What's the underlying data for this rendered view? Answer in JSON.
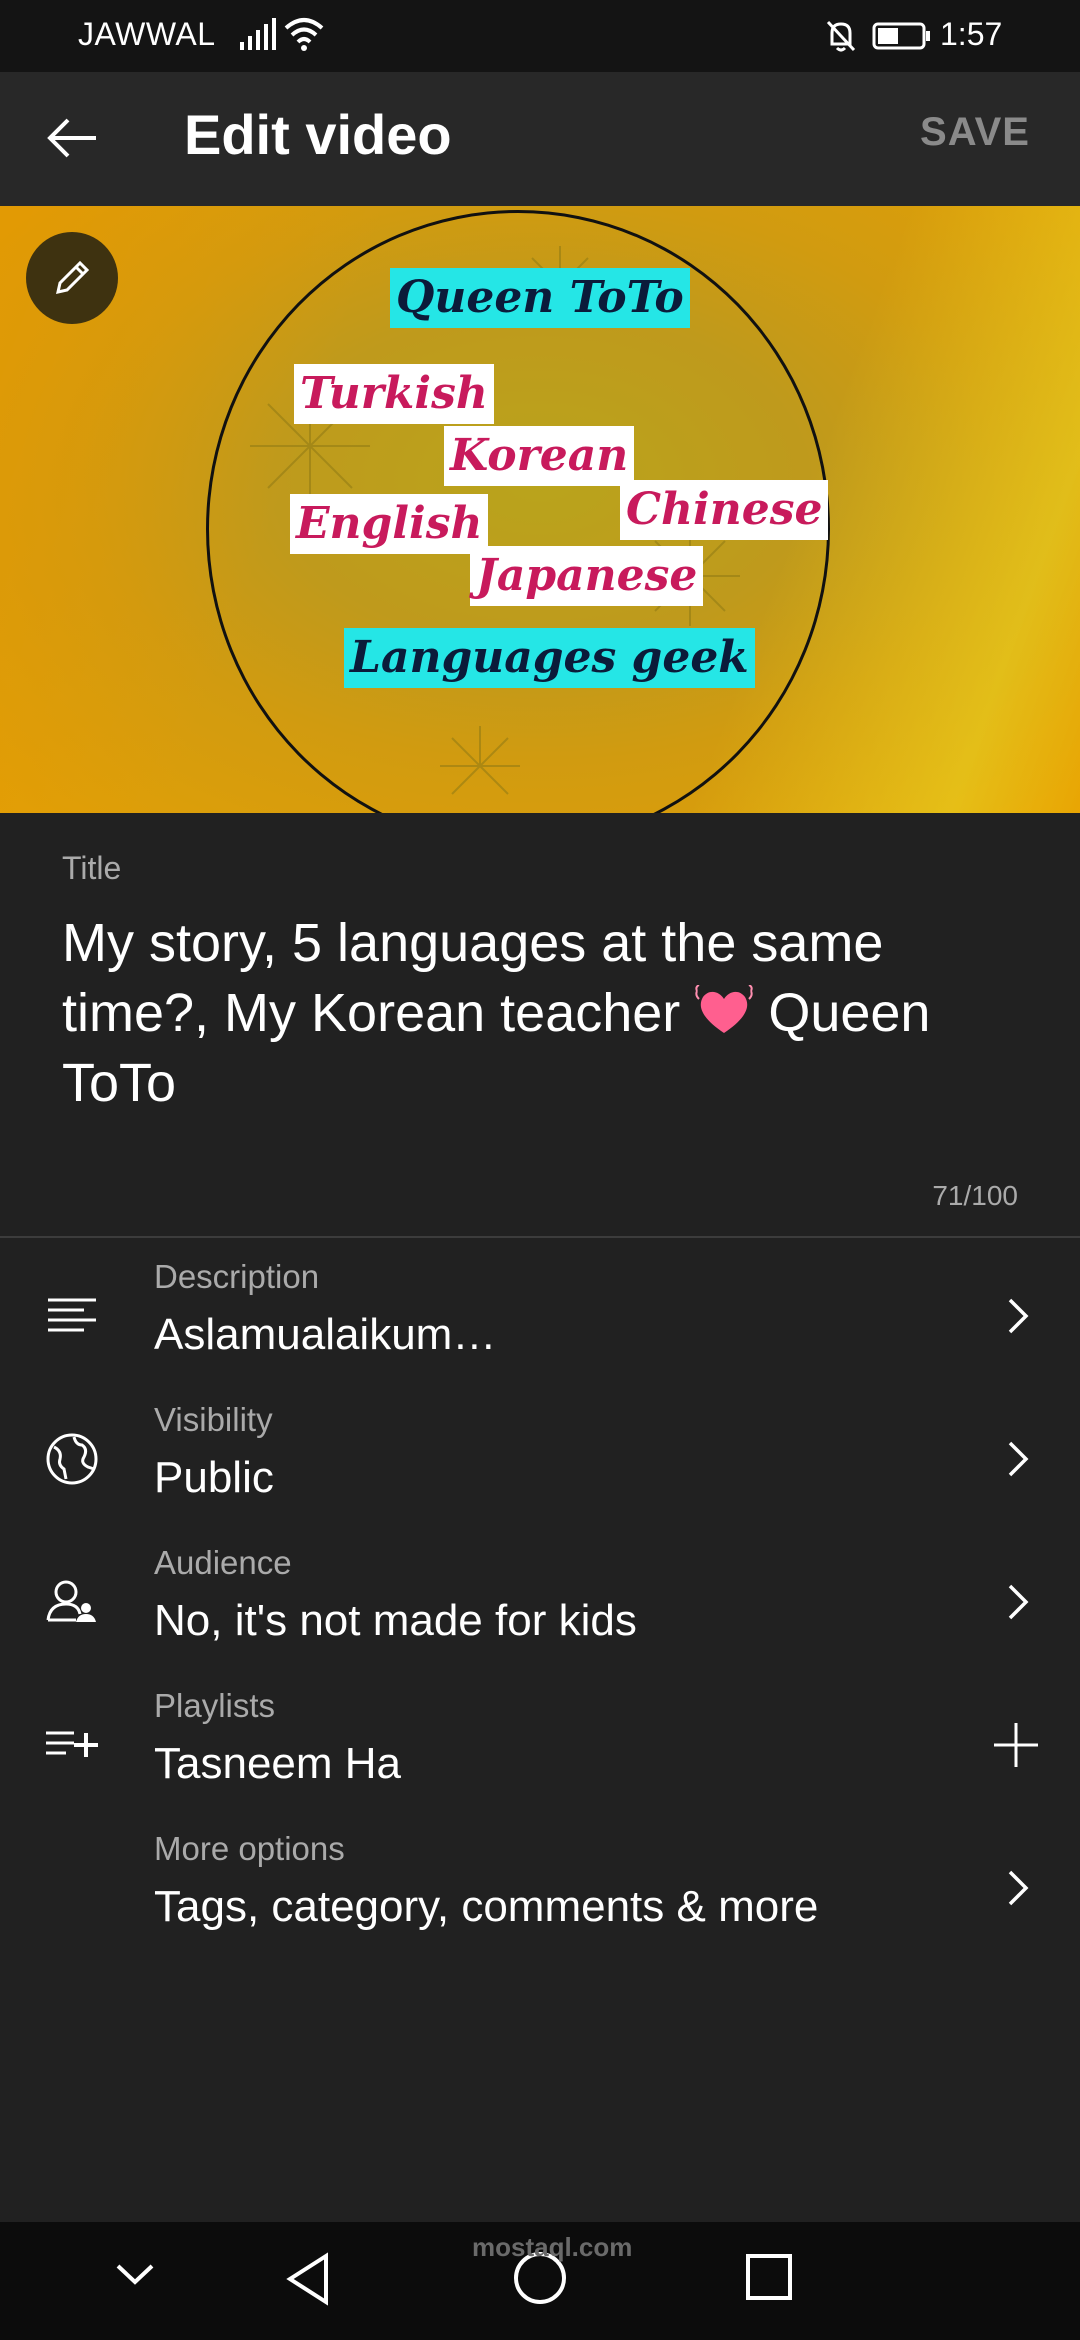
{
  "status_bar": {
    "carrier": "JAWWAL",
    "time": "1:57"
  },
  "app_bar": {
    "title": "Edit video",
    "save_label": "SAVE"
  },
  "thumbnail": {
    "tags": [
      "Queen ToTo",
      "Turkish",
      "Korean",
      "English",
      "Chinese",
      "Japanese",
      "Languages geek"
    ]
  },
  "title_field": {
    "label": "Title",
    "value_part1": "My story, 5 languages at the same time?, My Korean teacher",
    "value_part2": "Queen ToTo",
    "counter": "71/100"
  },
  "options": [
    {
      "label": "Description",
      "value": "Aslamualaikum…"
    },
    {
      "label": "Visibility",
      "value": "Public"
    },
    {
      "label": "Audience",
      "value": "No, it's not made for kids"
    },
    {
      "label": "Playlists",
      "value": "Tasneem Ha"
    },
    {
      "label": "More options",
      "value": "Tags, category, comments & more"
    }
  ],
  "watermark": {
    "text": "mostaql.com"
  },
  "colors": {
    "background": "#212121",
    "app_bar": "#282828",
    "save_disabled": "#8a8a8a",
    "tag_text": "#c81a5c",
    "tag_cyan": "#25e6e6"
  }
}
